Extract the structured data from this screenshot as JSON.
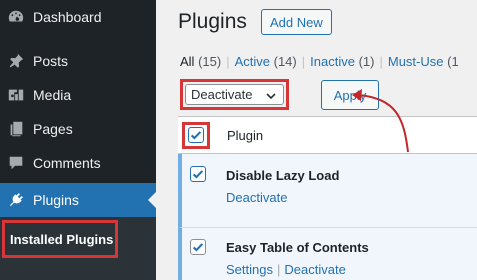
{
  "sidebar": {
    "items": [
      {
        "label": "Dashboard",
        "icon": "dashboard-icon"
      },
      {
        "label": "Posts",
        "icon": "pushpin-icon"
      },
      {
        "label": "Media",
        "icon": "media-icon"
      },
      {
        "label": "Pages",
        "icon": "pages-icon"
      },
      {
        "label": "Comments",
        "icon": "comments-icon"
      },
      {
        "label": "Plugins",
        "icon": "plugins-icon",
        "active": true
      }
    ],
    "submenu": {
      "current": "Installed Plugins"
    }
  },
  "main": {
    "title": "Plugins",
    "add_new": "Add New",
    "filters": [
      {
        "label": "All",
        "count": "(15)",
        "current": true
      },
      {
        "label": "Active",
        "count": "(14)"
      },
      {
        "label": "Inactive",
        "count": "(1)"
      },
      {
        "label": "Must-Use",
        "count": "(1"
      }
    ],
    "bulk_action": {
      "selected": "Deactivate"
    },
    "apply": "Apply",
    "table": {
      "header": "Plugin",
      "rows": [
        {
          "name": "Disable Lazy Load",
          "actions": [
            "Deactivate"
          ]
        },
        {
          "name": "Easy Table of Contents",
          "actions": [
            "Settings",
            "Deactivate"
          ]
        }
      ]
    }
  },
  "colors": {
    "accent": "#2271b1",
    "highlight": "#d63638",
    "sidebar": "#1d2327",
    "active_row": "#f0f6fc"
  }
}
